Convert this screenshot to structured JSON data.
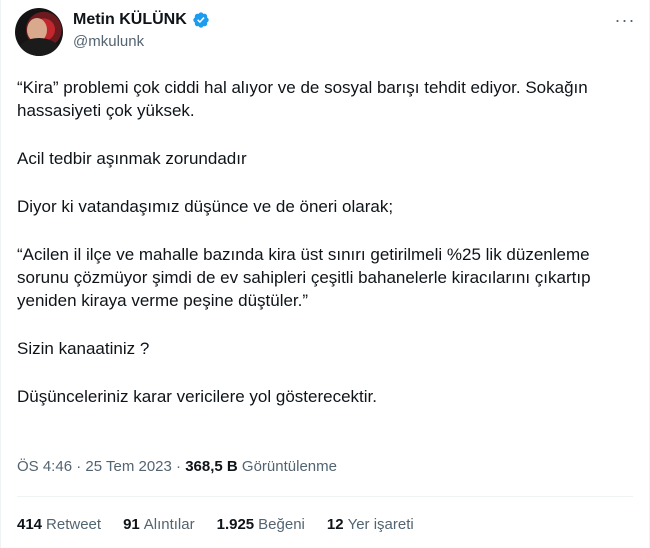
{
  "author": {
    "name": "Metin KÜLÜNK",
    "handle": "@mkulunk",
    "verified_icon": "verified-badge-icon",
    "badge_color": "#1d9bf0"
  },
  "tweet": {
    "paragraphs": [
      "“Kira” problemi çok ciddi hal alıyor ve de sosyal barışı tehdit ediyor. Sokağın hassasiyeti çok yüksek.",
      "Acil tedbir aşınmak zorundadır",
      "Diyor ki vatandaşımız düşünce ve de öneri olarak;",
      "“Acilen il ilçe ve mahalle bazında kira üst sınırı getirilmeli %25 lik düzenleme sorunu çözmüyor şimdi de ev sahipleri çeşitli bahanelerle kiracılarını çıkartıp yeniden kiraya verme peşine düştüler.”",
      "Sizin kanaatiniz ?",
      "Düşünceleriniz karar vericilere yol gösterecektir."
    ]
  },
  "meta": {
    "time": "ÖS 4:46",
    "separator": "·",
    "date": "25 Tem 2023",
    "views_count": "368,5 B",
    "views_label": "Görüntülenme"
  },
  "stats": {
    "retweets_count": "414",
    "retweets_label": "Retweet",
    "quotes_count": "91",
    "quotes_label": "Alıntılar",
    "likes_count": "1.925",
    "likes_label": "Beğeni",
    "bookmarks_count": "12",
    "bookmarks_label": "Yer işareti"
  },
  "more_icon": "more-options-icon"
}
